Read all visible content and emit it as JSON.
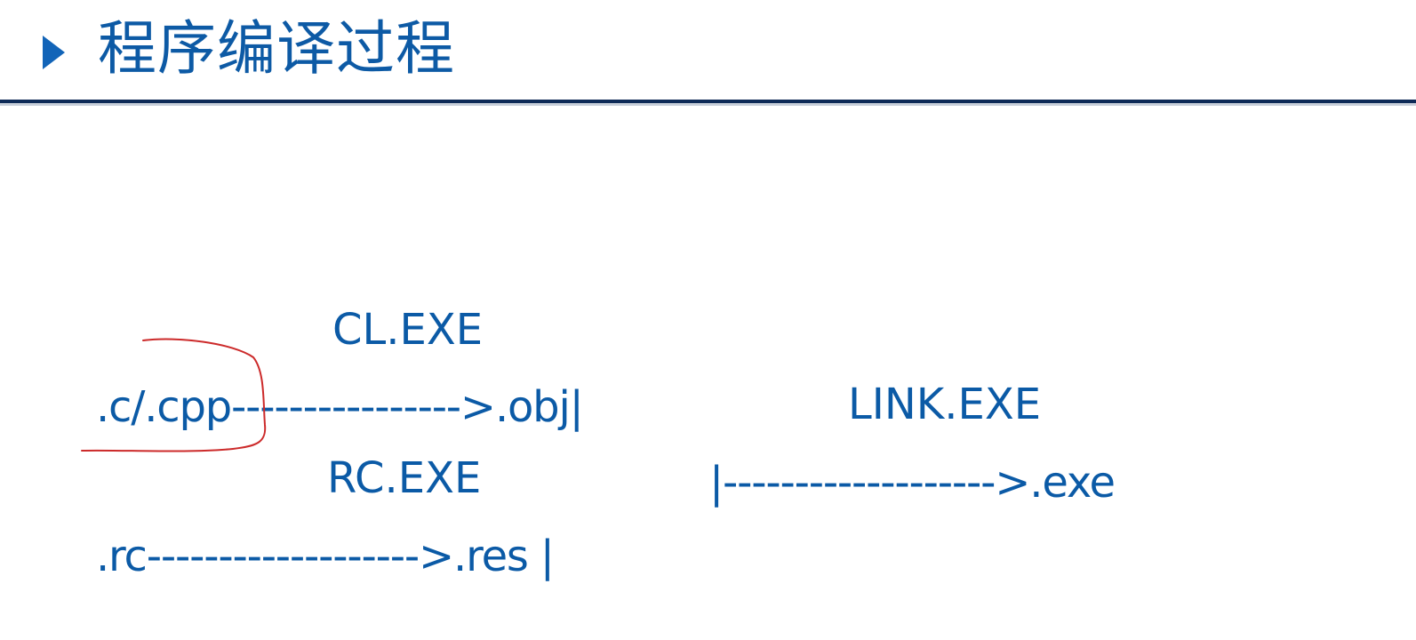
{
  "slide": {
    "title": "程序编译过程"
  },
  "diagram": {
    "compiler_label": "CL.EXE",
    "source_line": ".c/.cpp---------------->.obj|",
    "linker_label": "LINK.EXE",
    "resource_compiler_label": "RC.EXE",
    "link_line": "|------------------->.exe",
    "resource_line": ".rc------------------->.res |"
  },
  "colors": {
    "text": "#0b5aa6",
    "title": "#0d5aa5",
    "rule": "#0e2a57",
    "annotation": "#cc2a2a"
  }
}
